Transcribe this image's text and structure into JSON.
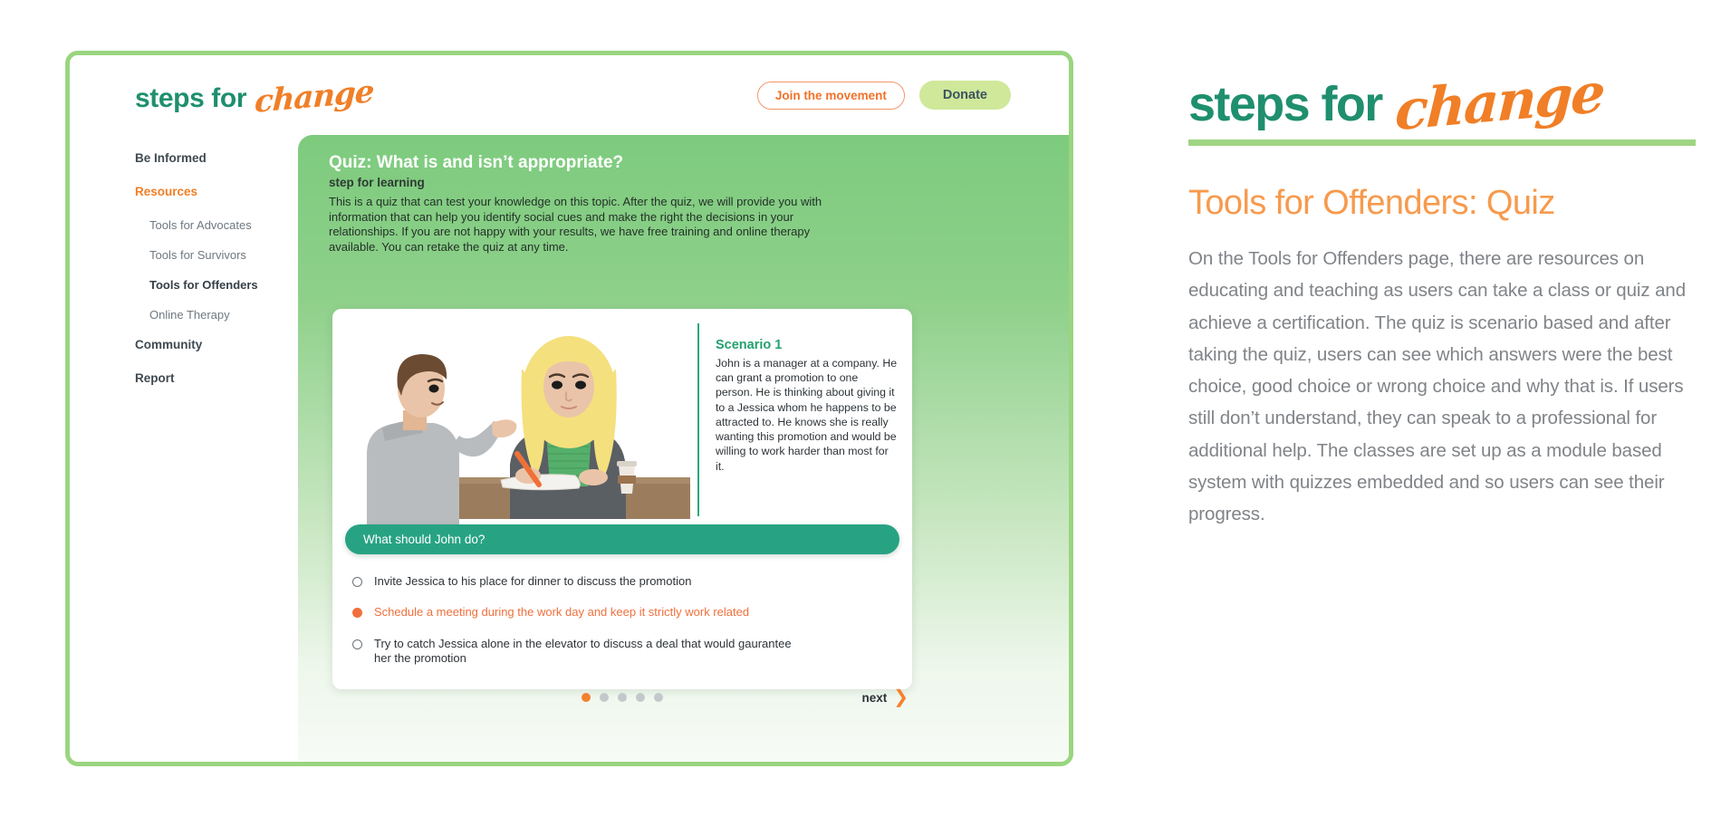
{
  "site": {
    "brand": {
      "primary": "steps for",
      "script": "change"
    },
    "header_buttons": {
      "join": "Join the movement",
      "donate": "Donate"
    }
  },
  "sidebar": {
    "items": [
      {
        "label": "Be Informed",
        "level": "top",
        "state": "default"
      },
      {
        "label": "Resources",
        "level": "top",
        "state": "active"
      },
      {
        "label": "Tools for Advocates",
        "level": "sub",
        "state": "default"
      },
      {
        "label": "Tools for Survivors",
        "level": "sub",
        "state": "default"
      },
      {
        "label": "Tools for Offenders",
        "level": "sub",
        "state": "current"
      },
      {
        "label": "Online Therapy",
        "level": "sub",
        "state": "default"
      },
      {
        "label": "Community",
        "level": "top",
        "state": "default"
      },
      {
        "label": "Report",
        "level": "top",
        "state": "default"
      }
    ]
  },
  "quiz": {
    "title": "Quiz: What is and isn’t appropriate?",
    "subtitle": "step for learning",
    "description": "This is a quiz that can test your knowledge on this topic. After the quiz, we will provide you with information that can help you identify social cues and make the right the decisions in your relationships. If you are not happy with your results, we have free training and online therapy available. You can retake the quiz at any time.",
    "scenario": {
      "title": "Scenario 1",
      "text": "John is a manager at a company. He can grant a promotion to one person. He is thinking about giving it to a Jessica whom he happens to be attracted to. He knows she is really wanting this promotion and would be willing to work harder than most for it."
    },
    "question": "What should John do?",
    "options": [
      {
        "label": "Invite Jessica to his place for dinner to discuss the promotion",
        "selected": false
      },
      {
        "label": "Schedule a meeting during the work day and keep it strictly work related",
        "selected": true
      },
      {
        "label": "Try to catch Jessica alone in the elevator to discuss a deal that would gaurantee her the promotion",
        "selected": false
      }
    ],
    "pagination": {
      "total": 5,
      "active": 1
    },
    "next_label": "next"
  },
  "illustration": {
    "name": "two-people-at-desk-illustration",
    "alt": "A man in a gray sweater standing and talking to a blonde woman in a gray blazer and green shirt seated at a brown desk with papers, an orange pencil and a coffee cup"
  },
  "description_panel": {
    "brand": {
      "primary": "steps for",
      "script": "change"
    },
    "title": "Tools for Offenders: Quiz",
    "body": "On the Tools for Offenders page, there are resources on educating and teaching as users can take a class or quiz and achieve a certification. The quiz is scenario based and after taking the quiz, users can see which answers were the best choice, good choice or wrong choice and why that is. If users still don’t understand, they can speak to a professional for additional help. The classes are set up as a module based system with quizzes embedded and so users can see their progress."
  },
  "colors": {
    "teal": "#1f8f6e",
    "orange": "#f07f27",
    "green_light": "#9ad57f",
    "green_panel": "#7dcb7e",
    "question_green": "#27a383",
    "donate_green": "#cfe89a",
    "body_gray": "#808488"
  }
}
